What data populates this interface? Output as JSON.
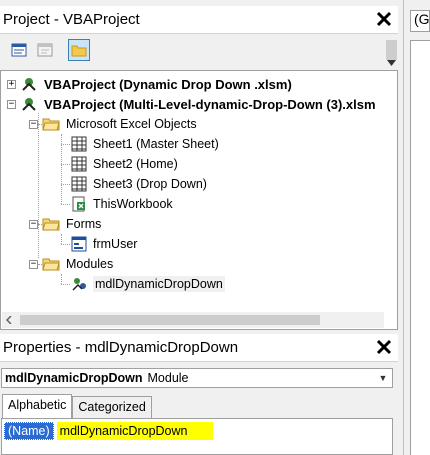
{
  "project_explorer": {
    "title": "Project - VBAProject",
    "tree": {
      "projects": [
        {
          "label": "VBAProject (Dynamic Drop Down .xlsm)",
          "expanded": false
        },
        {
          "label": "VBAProject (Multi-Level-dynamic-Drop-Down (3).xlsm",
          "expanded": true
        }
      ],
      "folders": {
        "excel_objects": "Microsoft Excel Objects",
        "forms": "Forms",
        "modules": "Modules"
      },
      "items": {
        "sheet1": "Sheet1 (Master Sheet)",
        "sheet2": "Sheet2 (Home)",
        "sheet3": "Sheet3 (Drop Down)",
        "thisworkbook": "ThisWorkbook",
        "frmuser": "frmUser",
        "module": "mdlDynamicDropDown"
      }
    }
  },
  "properties": {
    "title": "Properties - mdlDynamicDropDown",
    "object_name": "mdlDynamicDropDown",
    "object_type": "Module",
    "tabs": [
      "Alphabetic",
      "Categorized"
    ],
    "active_tab": "Alphabetic",
    "row": {
      "key": "(Name)",
      "value": "mdlDynamicDropDown"
    }
  },
  "code_window": {
    "object_combo_partial": "(G"
  }
}
